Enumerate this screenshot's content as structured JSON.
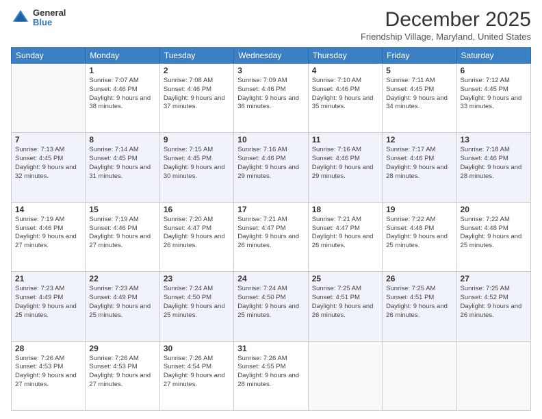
{
  "header": {
    "logo": {
      "line1": "General",
      "line2": "Blue"
    },
    "title": "December 2025",
    "location": "Friendship Village, Maryland, United States"
  },
  "weekdays": [
    "Sunday",
    "Monday",
    "Tuesday",
    "Wednesday",
    "Thursday",
    "Friday",
    "Saturday"
  ],
  "weeks": [
    [
      {
        "day": "",
        "sunrise": "",
        "sunset": "",
        "daylight": ""
      },
      {
        "day": "1",
        "sunrise": "7:07 AM",
        "sunset": "4:46 PM",
        "daylight": "9 hours and 38 minutes."
      },
      {
        "day": "2",
        "sunrise": "7:08 AM",
        "sunset": "4:46 PM",
        "daylight": "9 hours and 37 minutes."
      },
      {
        "day": "3",
        "sunrise": "7:09 AM",
        "sunset": "4:46 PM",
        "daylight": "9 hours and 36 minutes."
      },
      {
        "day": "4",
        "sunrise": "7:10 AM",
        "sunset": "4:46 PM",
        "daylight": "9 hours and 35 minutes."
      },
      {
        "day": "5",
        "sunrise": "7:11 AM",
        "sunset": "4:45 PM",
        "daylight": "9 hours and 34 minutes."
      },
      {
        "day": "6",
        "sunrise": "7:12 AM",
        "sunset": "4:45 PM",
        "daylight": "9 hours and 33 minutes."
      }
    ],
    [
      {
        "day": "7",
        "sunrise": "7:13 AM",
        "sunset": "4:45 PM",
        "daylight": "9 hours and 32 minutes."
      },
      {
        "day": "8",
        "sunrise": "7:14 AM",
        "sunset": "4:45 PM",
        "daylight": "9 hours and 31 minutes."
      },
      {
        "day": "9",
        "sunrise": "7:15 AM",
        "sunset": "4:45 PM",
        "daylight": "9 hours and 30 minutes."
      },
      {
        "day": "10",
        "sunrise": "7:16 AM",
        "sunset": "4:46 PM",
        "daylight": "9 hours and 29 minutes."
      },
      {
        "day": "11",
        "sunrise": "7:16 AM",
        "sunset": "4:46 PM",
        "daylight": "9 hours and 29 minutes."
      },
      {
        "day": "12",
        "sunrise": "7:17 AM",
        "sunset": "4:46 PM",
        "daylight": "9 hours and 28 minutes."
      },
      {
        "day": "13",
        "sunrise": "7:18 AM",
        "sunset": "4:46 PM",
        "daylight": "9 hours and 28 minutes."
      }
    ],
    [
      {
        "day": "14",
        "sunrise": "7:19 AM",
        "sunset": "4:46 PM",
        "daylight": "9 hours and 27 minutes."
      },
      {
        "day": "15",
        "sunrise": "7:19 AM",
        "sunset": "4:46 PM",
        "daylight": "9 hours and 27 minutes."
      },
      {
        "day": "16",
        "sunrise": "7:20 AM",
        "sunset": "4:47 PM",
        "daylight": "9 hours and 26 minutes."
      },
      {
        "day": "17",
        "sunrise": "7:21 AM",
        "sunset": "4:47 PM",
        "daylight": "9 hours and 26 minutes."
      },
      {
        "day": "18",
        "sunrise": "7:21 AM",
        "sunset": "4:47 PM",
        "daylight": "9 hours and 26 minutes."
      },
      {
        "day": "19",
        "sunrise": "7:22 AM",
        "sunset": "4:48 PM",
        "daylight": "9 hours and 25 minutes."
      },
      {
        "day": "20",
        "sunrise": "7:22 AM",
        "sunset": "4:48 PM",
        "daylight": "9 hours and 25 minutes."
      }
    ],
    [
      {
        "day": "21",
        "sunrise": "7:23 AM",
        "sunset": "4:49 PM",
        "daylight": "9 hours and 25 minutes."
      },
      {
        "day": "22",
        "sunrise": "7:23 AM",
        "sunset": "4:49 PM",
        "daylight": "9 hours and 25 minutes."
      },
      {
        "day": "23",
        "sunrise": "7:24 AM",
        "sunset": "4:50 PM",
        "daylight": "9 hours and 25 minutes."
      },
      {
        "day": "24",
        "sunrise": "7:24 AM",
        "sunset": "4:50 PM",
        "daylight": "9 hours and 25 minutes."
      },
      {
        "day": "25",
        "sunrise": "7:25 AM",
        "sunset": "4:51 PM",
        "daylight": "9 hours and 26 minutes."
      },
      {
        "day": "26",
        "sunrise": "7:25 AM",
        "sunset": "4:51 PM",
        "daylight": "9 hours and 26 minutes."
      },
      {
        "day": "27",
        "sunrise": "7:25 AM",
        "sunset": "4:52 PM",
        "daylight": "9 hours and 26 minutes."
      }
    ],
    [
      {
        "day": "28",
        "sunrise": "7:26 AM",
        "sunset": "4:53 PM",
        "daylight": "9 hours and 27 minutes."
      },
      {
        "day": "29",
        "sunrise": "7:26 AM",
        "sunset": "4:53 PM",
        "daylight": "9 hours and 27 minutes."
      },
      {
        "day": "30",
        "sunrise": "7:26 AM",
        "sunset": "4:54 PM",
        "daylight": "9 hours and 27 minutes."
      },
      {
        "day": "31",
        "sunrise": "7:26 AM",
        "sunset": "4:55 PM",
        "daylight": "9 hours and 28 minutes."
      },
      {
        "day": "",
        "sunrise": "",
        "sunset": "",
        "daylight": ""
      },
      {
        "day": "",
        "sunrise": "",
        "sunset": "",
        "daylight": ""
      },
      {
        "day": "",
        "sunrise": "",
        "sunset": "",
        "daylight": ""
      }
    ]
  ]
}
